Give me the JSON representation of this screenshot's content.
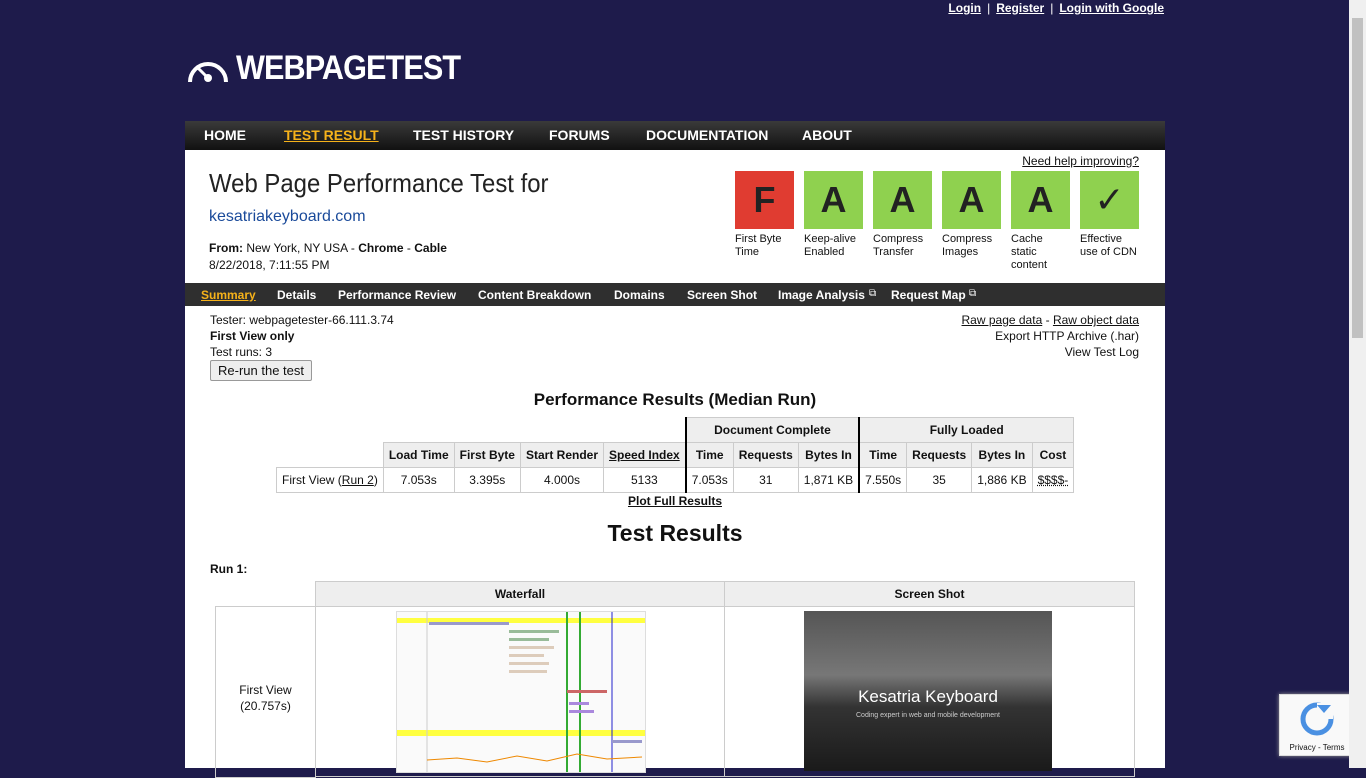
{
  "top_links": {
    "login": "Login",
    "register": "Register",
    "google": "Login with Google",
    "sep": "|"
  },
  "logo": {
    "text": "WEBPAGETEST"
  },
  "nav": [
    "HOME",
    "TEST RESULT",
    "TEST HISTORY",
    "FORUMS",
    "DOCUMENTATION",
    "ABOUT"
  ],
  "header": {
    "help": "Need help improving?",
    "title": "Web Page Performance Test for",
    "site": "kesatriakeyboard.com",
    "from_label": "From:",
    "from_location": "New York, NY USA",
    "from_sep": "-",
    "browser": "Chrome",
    "connection": "Cable",
    "date": "8/22/2018, 7:11:55 PM"
  },
  "grades": [
    {
      "grade": "F",
      "label": "First Byte Time",
      "color": "#e03c31"
    },
    {
      "grade": "A",
      "label": "Keep-alive Enabled",
      "color": "#8fd14f"
    },
    {
      "grade": "A",
      "label": "Compress Transfer",
      "color": "#8fd14f"
    },
    {
      "grade": "A",
      "label": "Compress Images",
      "color": "#8fd14f"
    },
    {
      "grade": "A",
      "label": "Cache static content",
      "color": "#8fd14f"
    },
    {
      "grade": "✓",
      "label": "Effective use of CDN",
      "color": "#8fd14f"
    }
  ],
  "subnav": [
    "Summary",
    "Details",
    "Performance Review",
    "Content Breakdown",
    "Domains",
    "Screen Shot",
    "Image Analysis",
    "Request Map"
  ],
  "info": {
    "tester": "Tester: webpagetester-66.111.3.74",
    "view": "First View only",
    "runs": "Test runs: 3",
    "rerun": "Re-run the test"
  },
  "right_links": [
    "Raw page data",
    "-",
    "Raw object data",
    "Export HTTP Archive (.har)",
    "View Test Log"
  ],
  "perf": {
    "heading": "Performance Results (Median Run)",
    "groups": [
      "Document Complete",
      "Fully Loaded"
    ],
    "columns": [
      "Load Time",
      "First Byte",
      "Start Render",
      "Speed Index",
      "Time",
      "Requests",
      "Bytes In",
      "Time",
      "Requests",
      "Bytes In",
      "Cost"
    ],
    "row": {
      "label": "First View (",
      "run_link": "Run 2",
      "close": ")",
      "values": [
        "7.053s",
        "3.395s",
        "4.000s",
        "5133",
        "7.053s",
        "31",
        "1,871 KB",
        "7.550s",
        "35",
        "1,886 KB",
        "$$$$-"
      ]
    },
    "plot": "Plot Full Results"
  },
  "results": {
    "heading": "Test Results",
    "run": "Run 1:",
    "waterfall": "Waterfall",
    "screenshot": "Screen Shot",
    "first_view": "First View",
    "fv_time": "(20.757s)",
    "shot_title": "Kesatria Keyboard",
    "shot_sub": "Coding expert in web and mobile development"
  },
  "recaptcha": {
    "text": "Privacy - Terms"
  }
}
